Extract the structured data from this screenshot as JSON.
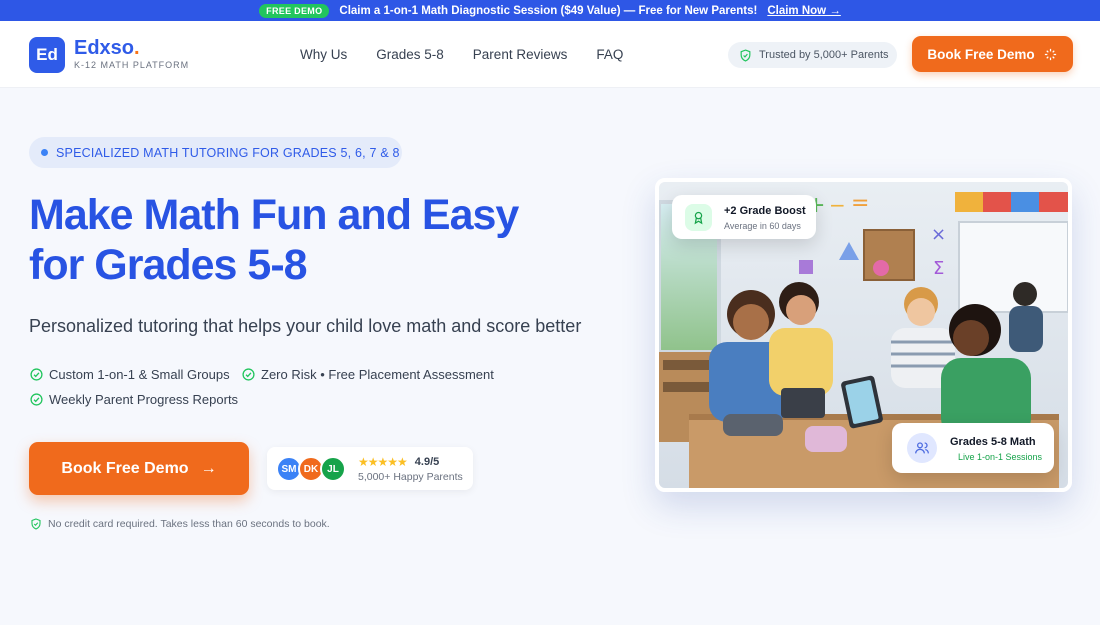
{
  "announcement": {
    "badge": "FREE DEMO",
    "text": "Claim a 1-on-1 Math Diagnostic Session ($49 Value) — Free for New Parents!",
    "link": "Claim Now →"
  },
  "header": {
    "logo_mark": "Ed",
    "brand": "Edxso",
    "brand_dot": ".",
    "tagline": "K-12 MATH PLATFORM",
    "nav": [
      "Why Us",
      "Grades 5-8",
      "Parent Reviews",
      "FAQ"
    ],
    "trusted": "Trusted by 5,000+ Parents",
    "demo_button": "Book Free Demo"
  },
  "hero": {
    "pill": "SPECIALIZED MATH TUTORING FOR GRADES 5, 6, 7 & 8",
    "headline_line1": "Make Math Fun and Easy",
    "headline_line2": "for Grades 5-8",
    "subheadline": "Personalized tutoring that helps your child love math and score better",
    "features": [
      "Custom 1-on-1 & Small Groups",
      "Zero Risk • Free Placement Assessment",
      "Weekly Parent Progress Reports"
    ],
    "cta": "Book Free Demo",
    "cta_arrow": "→",
    "avatars": [
      "SM",
      "DK",
      "JL"
    ],
    "stars": "★★★★★",
    "rating": "4.9/5",
    "happy_parents": "5,000+ Happy Parents",
    "note": "No credit card required. Takes less than 60 seconds to book."
  },
  "image_cards": {
    "boost_title": "+2 Grade Boost",
    "boost_sub": "Average in 60 days",
    "grades_title": "Grades 5-8 Math",
    "grades_sub": "Live 1-on-1 Sessions"
  },
  "colors": {
    "primary": "#2f5be8",
    "accent": "#f06a1c",
    "success": "#22c55e"
  }
}
